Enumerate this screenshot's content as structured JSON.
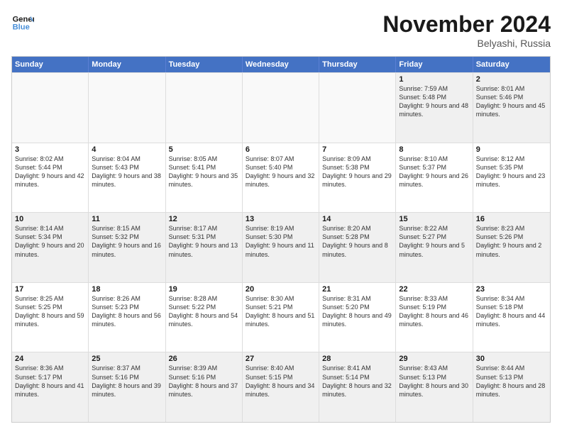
{
  "header": {
    "logo_line1": "General",
    "logo_line2": "Blue",
    "month_title": "November 2024",
    "location": "Belyashi, Russia"
  },
  "weekdays": [
    "Sunday",
    "Monday",
    "Tuesday",
    "Wednesday",
    "Thursday",
    "Friday",
    "Saturday"
  ],
  "rows": [
    [
      {
        "day": "",
        "sunrise": "",
        "sunset": "",
        "daylight": ""
      },
      {
        "day": "",
        "sunrise": "",
        "sunset": "",
        "daylight": ""
      },
      {
        "day": "",
        "sunrise": "",
        "sunset": "",
        "daylight": ""
      },
      {
        "day": "",
        "sunrise": "",
        "sunset": "",
        "daylight": ""
      },
      {
        "day": "",
        "sunrise": "",
        "sunset": "",
        "daylight": ""
      },
      {
        "day": "1",
        "sunrise": "Sunrise: 7:59 AM",
        "sunset": "Sunset: 5:48 PM",
        "daylight": "Daylight: 9 hours and 48 minutes."
      },
      {
        "day": "2",
        "sunrise": "Sunrise: 8:01 AM",
        "sunset": "Sunset: 5:46 PM",
        "daylight": "Daylight: 9 hours and 45 minutes."
      }
    ],
    [
      {
        "day": "3",
        "sunrise": "Sunrise: 8:02 AM",
        "sunset": "Sunset: 5:44 PM",
        "daylight": "Daylight: 9 hours and 42 minutes."
      },
      {
        "day": "4",
        "sunrise": "Sunrise: 8:04 AM",
        "sunset": "Sunset: 5:43 PM",
        "daylight": "Daylight: 9 hours and 38 minutes."
      },
      {
        "day": "5",
        "sunrise": "Sunrise: 8:05 AM",
        "sunset": "Sunset: 5:41 PM",
        "daylight": "Daylight: 9 hours and 35 minutes."
      },
      {
        "day": "6",
        "sunrise": "Sunrise: 8:07 AM",
        "sunset": "Sunset: 5:40 PM",
        "daylight": "Daylight: 9 hours and 32 minutes."
      },
      {
        "day": "7",
        "sunrise": "Sunrise: 8:09 AM",
        "sunset": "Sunset: 5:38 PM",
        "daylight": "Daylight: 9 hours and 29 minutes."
      },
      {
        "day": "8",
        "sunrise": "Sunrise: 8:10 AM",
        "sunset": "Sunset: 5:37 PM",
        "daylight": "Daylight: 9 hours and 26 minutes."
      },
      {
        "day": "9",
        "sunrise": "Sunrise: 8:12 AM",
        "sunset": "Sunset: 5:35 PM",
        "daylight": "Daylight: 9 hours and 23 minutes."
      }
    ],
    [
      {
        "day": "10",
        "sunrise": "Sunrise: 8:14 AM",
        "sunset": "Sunset: 5:34 PM",
        "daylight": "Daylight: 9 hours and 20 minutes."
      },
      {
        "day": "11",
        "sunrise": "Sunrise: 8:15 AM",
        "sunset": "Sunset: 5:32 PM",
        "daylight": "Daylight: 9 hours and 16 minutes."
      },
      {
        "day": "12",
        "sunrise": "Sunrise: 8:17 AM",
        "sunset": "Sunset: 5:31 PM",
        "daylight": "Daylight: 9 hours and 13 minutes."
      },
      {
        "day": "13",
        "sunrise": "Sunrise: 8:19 AM",
        "sunset": "Sunset: 5:30 PM",
        "daylight": "Daylight: 9 hours and 11 minutes."
      },
      {
        "day": "14",
        "sunrise": "Sunrise: 8:20 AM",
        "sunset": "Sunset: 5:28 PM",
        "daylight": "Daylight: 9 hours and 8 minutes."
      },
      {
        "day": "15",
        "sunrise": "Sunrise: 8:22 AM",
        "sunset": "Sunset: 5:27 PM",
        "daylight": "Daylight: 9 hours and 5 minutes."
      },
      {
        "day": "16",
        "sunrise": "Sunrise: 8:23 AM",
        "sunset": "Sunset: 5:26 PM",
        "daylight": "Daylight: 9 hours and 2 minutes."
      }
    ],
    [
      {
        "day": "17",
        "sunrise": "Sunrise: 8:25 AM",
        "sunset": "Sunset: 5:25 PM",
        "daylight": "Daylight: 8 hours and 59 minutes."
      },
      {
        "day": "18",
        "sunrise": "Sunrise: 8:26 AM",
        "sunset": "Sunset: 5:23 PM",
        "daylight": "Daylight: 8 hours and 56 minutes."
      },
      {
        "day": "19",
        "sunrise": "Sunrise: 8:28 AM",
        "sunset": "Sunset: 5:22 PM",
        "daylight": "Daylight: 8 hours and 54 minutes."
      },
      {
        "day": "20",
        "sunrise": "Sunrise: 8:30 AM",
        "sunset": "Sunset: 5:21 PM",
        "daylight": "Daylight: 8 hours and 51 minutes."
      },
      {
        "day": "21",
        "sunrise": "Sunrise: 8:31 AM",
        "sunset": "Sunset: 5:20 PM",
        "daylight": "Daylight: 8 hours and 49 minutes."
      },
      {
        "day": "22",
        "sunrise": "Sunrise: 8:33 AM",
        "sunset": "Sunset: 5:19 PM",
        "daylight": "Daylight: 8 hours and 46 minutes."
      },
      {
        "day": "23",
        "sunrise": "Sunrise: 8:34 AM",
        "sunset": "Sunset: 5:18 PM",
        "daylight": "Daylight: 8 hours and 44 minutes."
      }
    ],
    [
      {
        "day": "24",
        "sunrise": "Sunrise: 8:36 AM",
        "sunset": "Sunset: 5:17 PM",
        "daylight": "Daylight: 8 hours and 41 minutes."
      },
      {
        "day": "25",
        "sunrise": "Sunrise: 8:37 AM",
        "sunset": "Sunset: 5:16 PM",
        "daylight": "Daylight: 8 hours and 39 minutes."
      },
      {
        "day": "26",
        "sunrise": "Sunrise: 8:39 AM",
        "sunset": "Sunset: 5:16 PM",
        "daylight": "Daylight: 8 hours and 37 minutes."
      },
      {
        "day": "27",
        "sunrise": "Sunrise: 8:40 AM",
        "sunset": "Sunset: 5:15 PM",
        "daylight": "Daylight: 8 hours and 34 minutes."
      },
      {
        "day": "28",
        "sunrise": "Sunrise: 8:41 AM",
        "sunset": "Sunset: 5:14 PM",
        "daylight": "Daylight: 8 hours and 32 minutes."
      },
      {
        "day": "29",
        "sunrise": "Sunrise: 8:43 AM",
        "sunset": "Sunset: 5:13 PM",
        "daylight": "Daylight: 8 hours and 30 minutes."
      },
      {
        "day": "30",
        "sunrise": "Sunrise: 8:44 AM",
        "sunset": "Sunset: 5:13 PM",
        "daylight": "Daylight: 8 hours and 28 minutes."
      }
    ]
  ]
}
